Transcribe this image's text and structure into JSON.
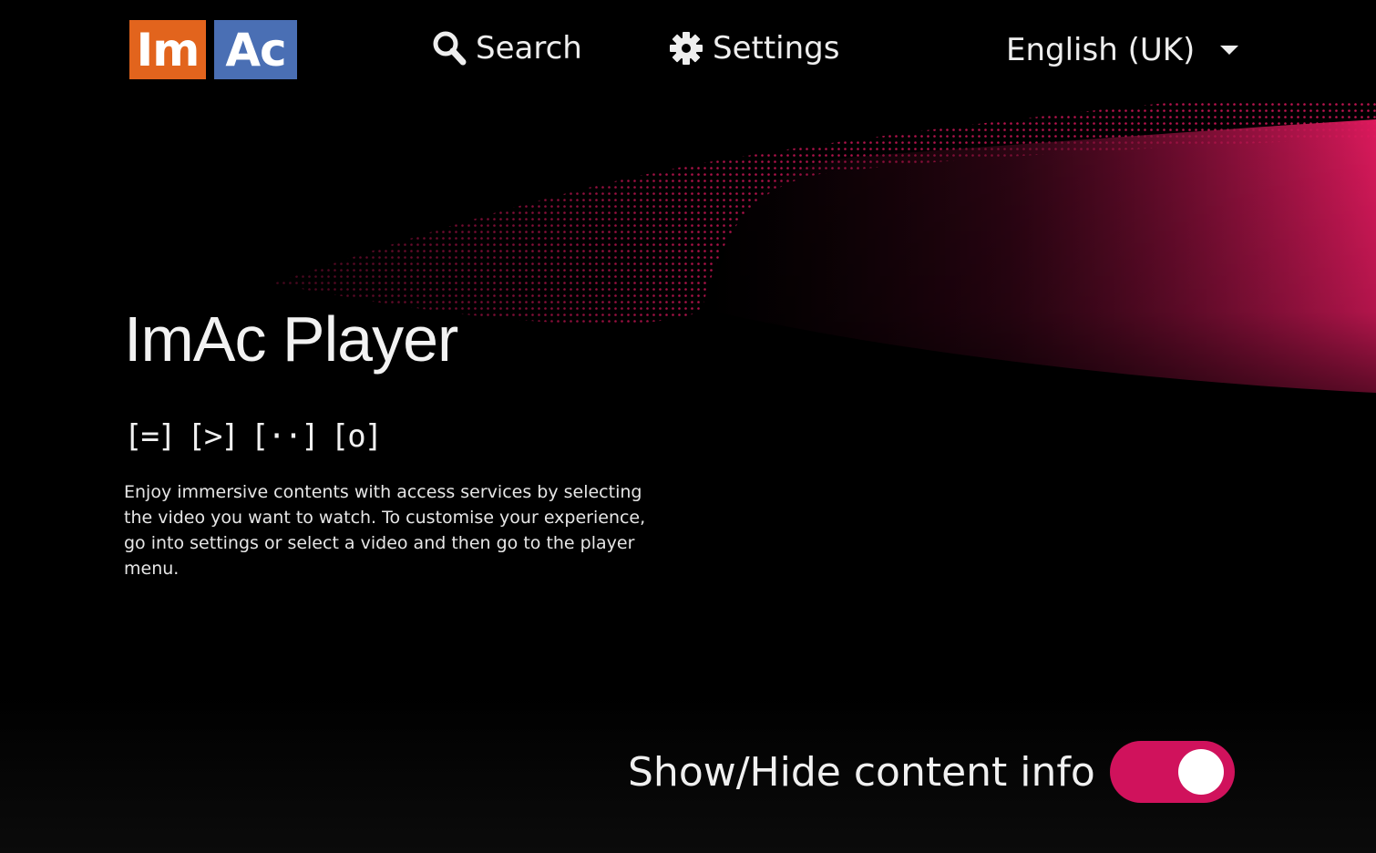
{
  "logo": {
    "part1": "Im",
    "part2": "Ac",
    "color1": "#e2641d",
    "color2": "#4a6fb4"
  },
  "nav": {
    "search_label": "Search",
    "settings_label": "Settings",
    "language_label": "English (UK)"
  },
  "hero": {
    "title": "ImAc Player",
    "service_icons": [
      "[=]",
      "[>]",
      "[··]",
      "[o]"
    ],
    "description": "Enjoy immersive contents with access services by selecting the video you want to watch. To customise your experience, go into settings or select a video and then go to the player menu."
  },
  "content_info_toggle": {
    "label": "Show/Hide content info",
    "on": true,
    "color": "#d0125c"
  },
  "colors": {
    "accent": "#d0125c",
    "background": "#000000"
  }
}
